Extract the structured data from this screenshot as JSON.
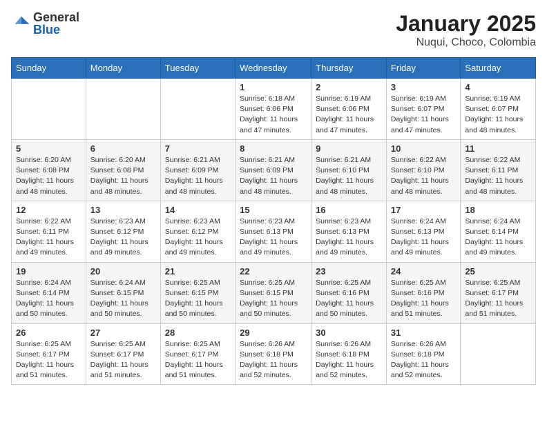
{
  "logo": {
    "general": "General",
    "blue": "Blue"
  },
  "title": "January 2025",
  "subtitle": "Nuqui, Choco, Colombia",
  "weekdays": [
    "Sunday",
    "Monday",
    "Tuesday",
    "Wednesday",
    "Thursday",
    "Friday",
    "Saturday"
  ],
  "weeks": [
    [
      {
        "day": "",
        "info": ""
      },
      {
        "day": "",
        "info": ""
      },
      {
        "day": "",
        "info": ""
      },
      {
        "day": "1",
        "info": "Sunrise: 6:18 AM\nSunset: 6:06 PM\nDaylight: 11 hours and 47 minutes."
      },
      {
        "day": "2",
        "info": "Sunrise: 6:19 AM\nSunset: 6:06 PM\nDaylight: 11 hours and 47 minutes."
      },
      {
        "day": "3",
        "info": "Sunrise: 6:19 AM\nSunset: 6:07 PM\nDaylight: 11 hours and 47 minutes."
      },
      {
        "day": "4",
        "info": "Sunrise: 6:19 AM\nSunset: 6:07 PM\nDaylight: 11 hours and 48 minutes."
      }
    ],
    [
      {
        "day": "5",
        "info": "Sunrise: 6:20 AM\nSunset: 6:08 PM\nDaylight: 11 hours and 48 minutes."
      },
      {
        "day": "6",
        "info": "Sunrise: 6:20 AM\nSunset: 6:08 PM\nDaylight: 11 hours and 48 minutes."
      },
      {
        "day": "7",
        "info": "Sunrise: 6:21 AM\nSunset: 6:09 PM\nDaylight: 11 hours and 48 minutes."
      },
      {
        "day": "8",
        "info": "Sunrise: 6:21 AM\nSunset: 6:09 PM\nDaylight: 11 hours and 48 minutes."
      },
      {
        "day": "9",
        "info": "Sunrise: 6:21 AM\nSunset: 6:10 PM\nDaylight: 11 hours and 48 minutes."
      },
      {
        "day": "10",
        "info": "Sunrise: 6:22 AM\nSunset: 6:10 PM\nDaylight: 11 hours and 48 minutes."
      },
      {
        "day": "11",
        "info": "Sunrise: 6:22 AM\nSunset: 6:11 PM\nDaylight: 11 hours and 48 minutes."
      }
    ],
    [
      {
        "day": "12",
        "info": "Sunrise: 6:22 AM\nSunset: 6:11 PM\nDaylight: 11 hours and 49 minutes."
      },
      {
        "day": "13",
        "info": "Sunrise: 6:23 AM\nSunset: 6:12 PM\nDaylight: 11 hours and 49 minutes."
      },
      {
        "day": "14",
        "info": "Sunrise: 6:23 AM\nSunset: 6:12 PM\nDaylight: 11 hours and 49 minutes."
      },
      {
        "day": "15",
        "info": "Sunrise: 6:23 AM\nSunset: 6:13 PM\nDaylight: 11 hours and 49 minutes."
      },
      {
        "day": "16",
        "info": "Sunrise: 6:23 AM\nSunset: 6:13 PM\nDaylight: 11 hours and 49 minutes."
      },
      {
        "day": "17",
        "info": "Sunrise: 6:24 AM\nSunset: 6:13 PM\nDaylight: 11 hours and 49 minutes."
      },
      {
        "day": "18",
        "info": "Sunrise: 6:24 AM\nSunset: 6:14 PM\nDaylight: 11 hours and 49 minutes."
      }
    ],
    [
      {
        "day": "19",
        "info": "Sunrise: 6:24 AM\nSunset: 6:14 PM\nDaylight: 11 hours and 50 minutes."
      },
      {
        "day": "20",
        "info": "Sunrise: 6:24 AM\nSunset: 6:15 PM\nDaylight: 11 hours and 50 minutes."
      },
      {
        "day": "21",
        "info": "Sunrise: 6:25 AM\nSunset: 6:15 PM\nDaylight: 11 hours and 50 minutes."
      },
      {
        "day": "22",
        "info": "Sunrise: 6:25 AM\nSunset: 6:15 PM\nDaylight: 11 hours and 50 minutes."
      },
      {
        "day": "23",
        "info": "Sunrise: 6:25 AM\nSunset: 6:16 PM\nDaylight: 11 hours and 50 minutes."
      },
      {
        "day": "24",
        "info": "Sunrise: 6:25 AM\nSunset: 6:16 PM\nDaylight: 11 hours and 51 minutes."
      },
      {
        "day": "25",
        "info": "Sunrise: 6:25 AM\nSunset: 6:17 PM\nDaylight: 11 hours and 51 minutes."
      }
    ],
    [
      {
        "day": "26",
        "info": "Sunrise: 6:25 AM\nSunset: 6:17 PM\nDaylight: 11 hours and 51 minutes."
      },
      {
        "day": "27",
        "info": "Sunrise: 6:25 AM\nSunset: 6:17 PM\nDaylight: 11 hours and 51 minutes."
      },
      {
        "day": "28",
        "info": "Sunrise: 6:25 AM\nSunset: 6:17 PM\nDaylight: 11 hours and 51 minutes."
      },
      {
        "day": "29",
        "info": "Sunrise: 6:26 AM\nSunset: 6:18 PM\nDaylight: 11 hours and 52 minutes."
      },
      {
        "day": "30",
        "info": "Sunrise: 6:26 AM\nSunset: 6:18 PM\nDaylight: 11 hours and 52 minutes."
      },
      {
        "day": "31",
        "info": "Sunrise: 6:26 AM\nSunset: 6:18 PM\nDaylight: 11 hours and 52 minutes."
      },
      {
        "day": "",
        "info": ""
      }
    ]
  ]
}
